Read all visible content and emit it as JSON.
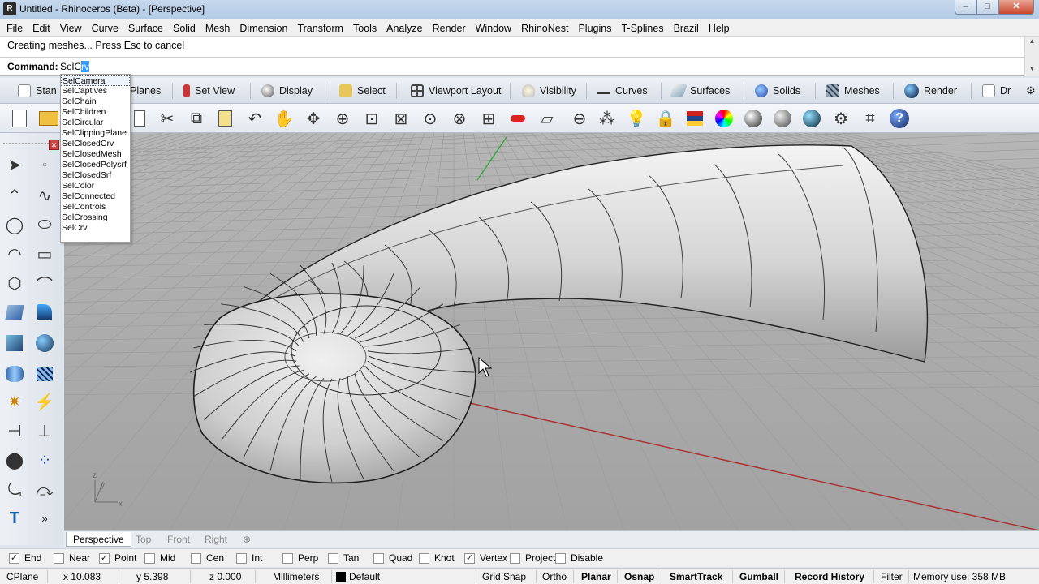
{
  "window": {
    "title": "Untitled - Rhinoceros (Beta) - [Perspective]",
    "controls": [
      "–",
      "□",
      "✕"
    ]
  },
  "menu": [
    "File",
    "Edit",
    "View",
    "Curve",
    "Surface",
    "Solid",
    "Mesh",
    "Dimension",
    "Transform",
    "Tools",
    "Analyze",
    "Render",
    "Window",
    "RhinoNest",
    "Plugins",
    "T-Splines",
    "Brazil",
    "Help"
  ],
  "command": {
    "history": "Creating meshes... Press Esc to cancel",
    "label": "Command:",
    "typed": "SelC",
    "autocomplete_selected": "rv"
  },
  "autocomplete": [
    "SelCamera",
    "SelCaptives",
    "SelChain",
    "SelChildren",
    "SelCircular",
    "SelClippingPlane",
    "SelClosedCrv",
    "SelClosedMesh",
    "SelClosedPolysrf",
    "SelClosedSrf",
    "SelColor",
    "SelConnected",
    "SelControls",
    "SelCrossing",
    "SelCrv"
  ],
  "toolbar_tabs": [
    "Stan",
    "Planes",
    "Set View",
    "Display",
    "Select",
    "Viewport Layout",
    "Visibility",
    "Curves",
    "Surfaces",
    "Solids",
    "Meshes",
    "Render",
    "Dr"
  ],
  "viewport": {
    "axis_labels": [
      "z",
      "y",
      "x"
    ]
  },
  "viewport_tabs": [
    "Perspective",
    "Top",
    "Front",
    "Right",
    "⊕"
  ],
  "osnaps": [
    {
      "label": "End",
      "checked": true
    },
    {
      "label": "Near",
      "checked": false
    },
    {
      "label": "Point",
      "checked": true
    },
    {
      "label": "Mid",
      "checked": false
    },
    {
      "label": "Cen",
      "checked": false
    },
    {
      "label": "Int",
      "checked": false
    },
    {
      "label": "Perp",
      "checked": false
    },
    {
      "label": "Tan",
      "checked": false
    },
    {
      "label": "Quad",
      "checked": false
    },
    {
      "label": "Knot",
      "checked": false
    },
    {
      "label": "Vertex",
      "checked": true
    },
    {
      "label": "Project",
      "checked": false
    },
    {
      "label": "Disable",
      "checked": false
    }
  ],
  "status": {
    "cplane": "CPlane",
    "x": "x 10.083",
    "y": "y 5.398",
    "z": "z 0.000",
    "units": "Millimeters",
    "layer": "Default",
    "grid_snap": "Grid Snap",
    "ortho": "Ortho",
    "planar": "Planar",
    "osnap": "Osnap",
    "smarttrack": "SmartTrack",
    "gumball": "Gumball",
    "record_history": "Record History",
    "filter": "Filter",
    "memory": "Memory use: 358 MB"
  }
}
